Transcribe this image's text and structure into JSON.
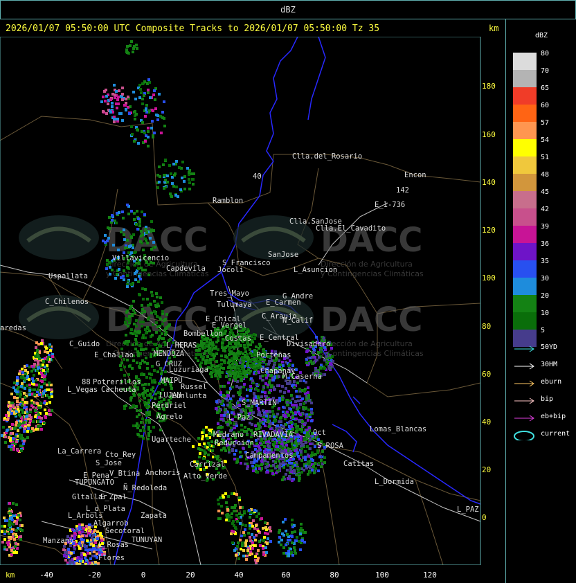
{
  "window": {
    "title": "dBZ"
  },
  "header": {
    "line": "2026/01/07 05:50:00 UTC Composite Tracks to 2026/01/07 05:50:00 Tz 35",
    "unit_top": "km",
    "unit_bottom": "km"
  },
  "x_axis_ticks": [
    "-40",
    "-20",
    "0",
    "20",
    "40",
    "60",
    "80",
    "100",
    "120"
  ],
  "y_axis_ticks": [
    "180",
    "160",
    "140",
    "120",
    "100",
    "80",
    "60",
    "40",
    "20",
    "0"
  ],
  "legend": {
    "title": "dBZ",
    "scale": [
      {
        "value": "80",
        "color": "#dcdcdc"
      },
      {
        "value": "70",
        "color": "#b4b4b4"
      },
      {
        "value": "65",
        "color": "#f03c28"
      },
      {
        "value": "60",
        "color": "#ff6414"
      },
      {
        "value": "57",
        "color": "#ff9650"
      },
      {
        "value": "54",
        "color": "#ffff00"
      },
      {
        "value": "51",
        "color": "#f0c83c"
      },
      {
        "value": "48",
        "color": "#d2963c"
      },
      {
        "value": "45",
        "color": "#c86e8c"
      },
      {
        "value": "42",
        "color": "#c8508c"
      },
      {
        "value": "39",
        "color": "#c81496"
      },
      {
        "value": "36",
        "color": "#6e14c8"
      },
      {
        "value": "35",
        "color": "#2850f0"
      },
      {
        "value": "30",
        "color": "#1e8cdc"
      },
      {
        "value": "20",
        "color": "#148214"
      },
      {
        "value": "10",
        "color": "#0a6e0a"
      },
      {
        "value": "5",
        "color": "#463c8c"
      }
    ],
    "tracks": [
      {
        "label": "50YD",
        "color": "#40e0e0"
      },
      {
        "label": "30HM",
        "color": "#ffffff"
      },
      {
        "label": "eburn",
        "color": "#ffc864"
      },
      {
        "label": "bip",
        "color": "#ffc8c8"
      },
      {
        "label": "eb+bip",
        "color": "#e040e0"
      },
      {
        "label": "current",
        "color": "#40e0e0"
      }
    ]
  },
  "watermark": {
    "brand": "DACC",
    "line1": "Dirección de Agricultura",
    "line2": "y Contingencias Climáticas"
  },
  "places": [
    {
      "name": "Clla.del_Rosario"
    },
    {
      "name": "Encon"
    },
    {
      "name": "142"
    },
    {
      "name": "E_1-736"
    },
    {
      "name": "Ramblon"
    },
    {
      "name": "Clla.SanJose"
    },
    {
      "name": "Clla.El_Cavadito"
    },
    {
      "name": "Villavicencio"
    },
    {
      "name": "S_Francisco"
    },
    {
      "name": "SanJose"
    },
    {
      "name": "Capdevila"
    },
    {
      "name": "Jocoli"
    },
    {
      "name": "L_Asuncion"
    },
    {
      "name": "Uspallata"
    },
    {
      "name": "Tres_Mayo"
    },
    {
      "name": "G_Andre"
    },
    {
      "name": "C_Chilenos"
    },
    {
      "name": "Tulumaya"
    },
    {
      "name": "E_Carmen"
    },
    {
      "name": "E_Chical"
    },
    {
      "name": "C_Araujo"
    },
    {
      "name": "N_Calif"
    },
    {
      "name": "E_Vergel"
    },
    {
      "name": "aredas"
    },
    {
      "name": "Bombellon"
    },
    {
      "name": "Costas"
    },
    {
      "name": "E_Central"
    },
    {
      "name": "C_Guido"
    },
    {
      "name": "L_HERAS"
    },
    {
      "name": "Divisadero"
    },
    {
      "name": "E_Challao"
    },
    {
      "name": "MENDOZA"
    },
    {
      "name": "Porteñas"
    },
    {
      "name": "G_CRUZ"
    },
    {
      "name": "Luzuriaga"
    },
    {
      "name": "Chapanay"
    },
    {
      "name": "Potrerillos"
    },
    {
      "name": "L_Vegas"
    },
    {
      "name": "Cacheuta"
    },
    {
      "name": "MAIPU"
    },
    {
      "name": "Russel"
    },
    {
      "name": "M_Caserna"
    },
    {
      "name": "LUJAN"
    },
    {
      "name": "Lunlunta"
    },
    {
      "name": "S_MARTIN"
    },
    {
      "name": "Perdriel"
    },
    {
      "name": "Agrelo"
    },
    {
      "name": "Ugarteche"
    },
    {
      "name": "L_Paz"
    },
    {
      "name": "Lomas_Blancas"
    },
    {
      "name": "RIVADAVIA"
    },
    {
      "name": "Medrano"
    },
    {
      "name": "Reduccion"
    },
    {
      "name": "Oct"
    },
    {
      "name": "La_Carrera"
    },
    {
      "name": "Cto_Rey"
    },
    {
      "name": "S_Jose"
    },
    {
      "name": "Carrizal"
    },
    {
      "name": "Campamentos"
    },
    {
      "name": "S_ROSA"
    },
    {
      "name": "Catitas"
    },
    {
      "name": "E_Pena"
    },
    {
      "name": "V_Btina"
    },
    {
      "name": "Anchoris"
    },
    {
      "name": "Alto_Verde"
    },
    {
      "name": "TUPUNGATO"
    },
    {
      "name": "Ñ_Redoleda"
    },
    {
      "name": "L_Dormida"
    },
    {
      "name": "Gltallar"
    },
    {
      "name": "E_Zpal"
    },
    {
      "name": "L_d_Plata"
    },
    {
      "name": "L_Arbols"
    },
    {
      "name": "Zapata"
    },
    {
      "name": "Algarrob"
    },
    {
      "name": "Secotoral"
    },
    {
      "name": "Manzano"
    },
    {
      "name": "TUNUYAN"
    },
    {
      "name": "L_Rosas"
    },
    {
      "name": "Flores"
    },
    {
      "name": "L_PAZ"
    },
    {
      "name": "40"
    },
    {
      "name": "88"
    }
  ]
}
